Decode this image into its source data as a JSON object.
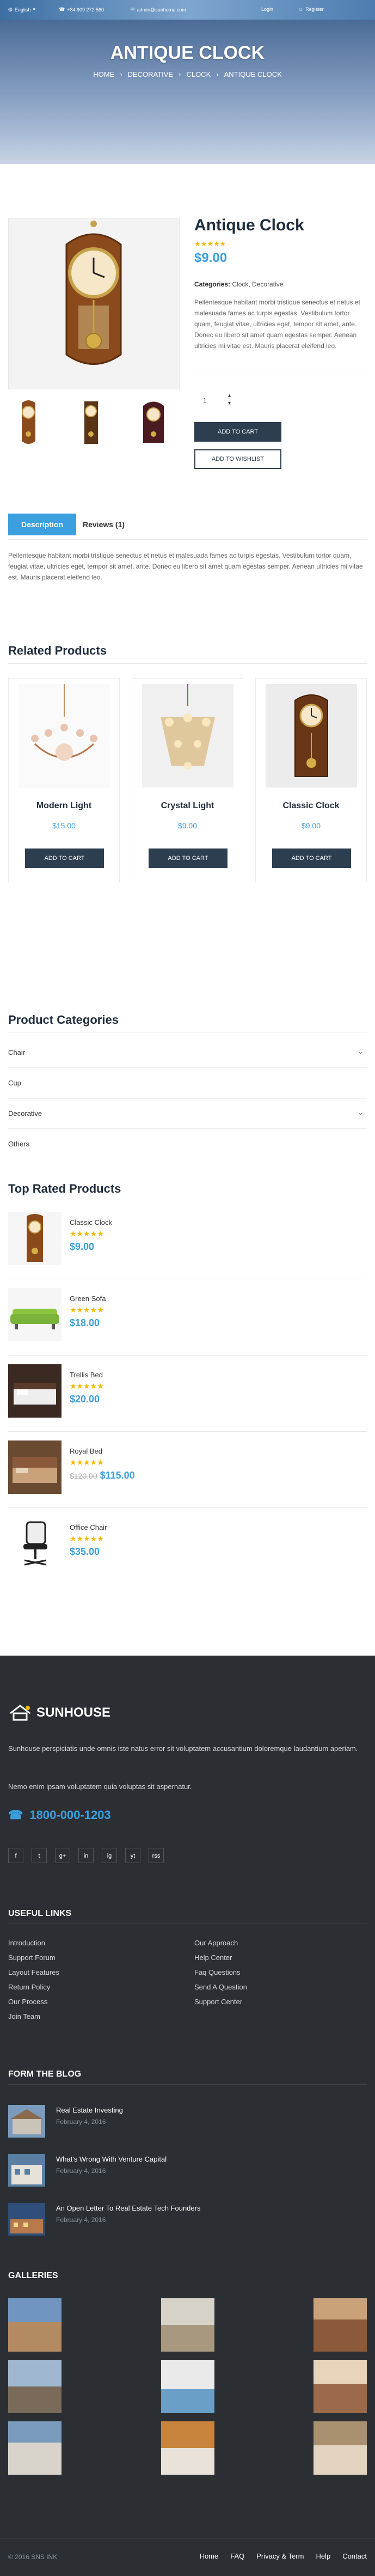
{
  "topbar": {
    "language": "English",
    "phone": "+84 909 272 560",
    "email": "admin@sunhome.com",
    "login": "Login",
    "register": "Register"
  },
  "hero": {
    "title": "ANTIQUE CLOCK",
    "crumbs": [
      "HOME",
      "DECORATIVE",
      "CLOCK",
      "ANTIQUE CLOCK"
    ]
  },
  "product": {
    "name": "Antique Clock",
    "rating": 5,
    "price": "$9.00",
    "categories_label": "Categories:",
    "categories": "Clock, Decorative",
    "description": "Pellentesque habitant morbi tristique senectus et netus et malesuada fames ac turpis egestas. Vestibulum tortor quam, feugiat vitae, ultricies eget, tempor sit amet, ante. Donec eu libero sit amet quam egestas semper. Aenean ultricies mi vitae est. Mauris placerat eleifend leo.",
    "quantity": "1",
    "add_to_cart": "ADD TO CART",
    "add_to_wishlist": "ADD TO WISHLIST"
  },
  "tabs": {
    "description": "Description",
    "reviews": "Reviews (1)",
    "content": "Pellentesque habitant morbi tristique senectus et netus et malesuada fames ac turpis egestas. Vestibulum tortor quam, feugiat vitae, ultricies eget, tempor sit amet, ante. Donec eu libero sit amet quam egestas semper. Aenean ultricies mi vitae est. Mauris placerat eleifend leo."
  },
  "related": {
    "title": "Related Products",
    "button_label": "ADD TO CART",
    "items": [
      {
        "name": "Modern Light",
        "price": "$15.00"
      },
      {
        "name": "Crystal Light",
        "price": "$9.00"
      },
      {
        "name": "Classic Clock",
        "price": "$9.00"
      }
    ]
  },
  "categories": {
    "title": "Product Categories",
    "items": [
      "Chair",
      "Cup",
      "Decorative",
      "Others"
    ]
  },
  "top_rated": {
    "title": "Top Rated Products",
    "items": [
      {
        "name": "Classic Clock",
        "price": "$9.00",
        "old_price": ""
      },
      {
        "name": "Green Sofa",
        "price": "$18.00",
        "old_price": ""
      },
      {
        "name": "Trellis Bed",
        "price": "$20.00",
        "old_price": ""
      },
      {
        "name": "Royal Bed",
        "price": "$115.00",
        "old_price": "$120.00"
      },
      {
        "name": "Office Chair",
        "price": "$35.00",
        "old_price": ""
      }
    ]
  },
  "footer": {
    "brand": "SUNHOUSE",
    "text1": "Sunhouse perspiciatis unde omnis iste natus error sit voluptatem accusantium doloremque laudantium aperiam.",
    "text2": "Nemo enim ipsam voluptatem quia voluptas sit aspernatur.",
    "phone": "1800-000-1203",
    "social": [
      "f",
      "t",
      "g+",
      "in",
      "ig",
      "yt",
      "rss"
    ],
    "useful_links_title": "USEFUL LINKS",
    "links_left": [
      "Introduction",
      "Support Forum",
      "Layout Features",
      "Return Policy",
      "Our Process",
      "Join Team"
    ],
    "links_right": [
      "Our Approach",
      "Help Center",
      "Faq Questions",
      "Send A Question",
      "Support Center"
    ],
    "blog_title": "FORM THE BLOG",
    "blog": [
      {
        "title": "Real Estate Investing",
        "date": "February 4, 2016"
      },
      {
        "title": "What's Wrong With Venture Capital",
        "date": "February 4, 2016"
      },
      {
        "title": "An Open Letter To Real Estate Tech Founders",
        "date": "February 4, 2016"
      }
    ],
    "galleries_title": "GALLERIES",
    "copyright": "© 2016 SNS INK",
    "bottom_links": [
      "Home",
      "FAQ",
      "Privacy & Term",
      "Help",
      "Contact"
    ]
  }
}
